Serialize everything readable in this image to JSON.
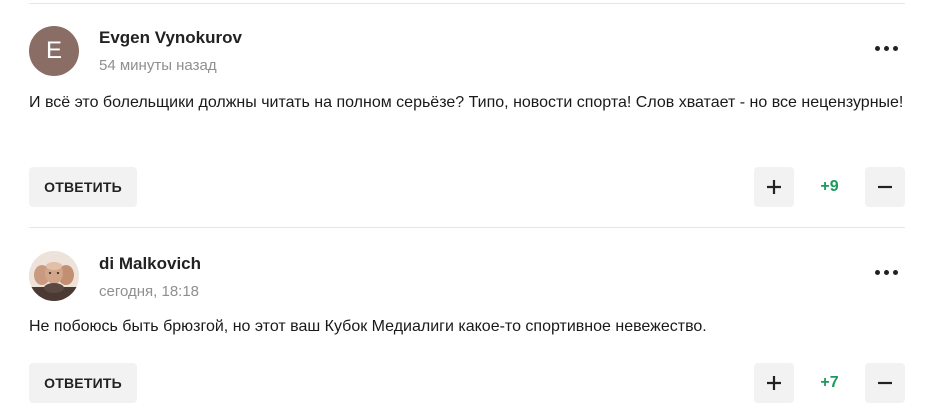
{
  "colors": {
    "score_positive": "#1a9b5c",
    "avatar_letter_bg": "#8a6e66"
  },
  "comments": [
    {
      "avatar_letter": "E",
      "author": "Evgen Vynokurov",
      "time": "54 минуты назад",
      "text": "И всё это болельщики должны читать на полном серьёзе? Типо, новости спорта! Слов хватает - но все нецензурные!",
      "reply_label": "ОТВЕТИТЬ",
      "score": "+9"
    },
    {
      "avatar_letter": "",
      "author": "di Malkovich",
      "time": "сегодня, 18:18",
      "text": "Не побоюсь быть брюзгой, но этот ваш Кубок Медиалиги какое-то спортивное невежество.",
      "reply_label": "ОТВЕТИТЬ",
      "score": "+7"
    }
  ]
}
